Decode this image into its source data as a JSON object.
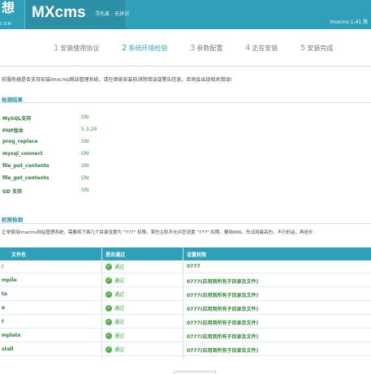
{
  "header": {
    "logo_char": "想",
    "logo_small": "COM",
    "brand": "MXcms",
    "slogan": "寻先离 - 无拼识",
    "version": "Imxcms 1.41 简"
  },
  "steps": [
    {
      "num": "1",
      "label": "安装使用协议",
      "active": false
    },
    {
      "num": "2",
      "label": "系统环境检验",
      "active": true
    },
    {
      "num": "3",
      "label": "参数配置",
      "active": false
    },
    {
      "num": "4",
      "label": "正在安装",
      "active": false
    },
    {
      "num": "5",
      "label": "安装完成",
      "active": false
    }
  ],
  "intro": "前服务器是否支持安装Imxcms网站管理系统，请在继续安装前消除错误或警告信息，否则会出现相关错误!",
  "env": {
    "title": "检测结果",
    "rows": [
      {
        "key": "MySQL支持",
        "value": "ON"
      },
      {
        "key": "PHP版本",
        "value": "5.3.29"
      },
      {
        "key": "preg_replace",
        "value": "ON"
      },
      {
        "key": "mysql_connect",
        "value": "ON"
      },
      {
        "key": "file_put_contents",
        "value": "ON"
      },
      {
        "key": "file_get_contents",
        "value": "ON"
      },
      {
        "key": "GD 支持",
        "value": "ON"
      }
    ]
  },
  "perm": {
    "title": "权限检测",
    "intro": "正常使用Imxcms网站管理系统，需要将下面几个目录设置为 \"777\" 权限。某些主机不允许您设置 \"777\" 权限，要用666。先试用最高的，不行的话，再逐步",
    "headers": {
      "name": "文件名",
      "status": "是否通过",
      "perm": "设置权限"
    },
    "rows": [
      {
        "name": "/",
        "status": "通过",
        "perm": "0777"
      },
      {
        "name": "mpile",
        "status": "通过",
        "perm": "0777(应用到所有子目录及文件)"
      },
      {
        "name": "ta",
        "status": "通过",
        "perm": "0777(应用到所有子目录及文件)"
      },
      {
        "name": "e",
        "status": "通过",
        "perm": "0777(应用到所有子目录及文件)"
      },
      {
        "name": "t",
        "status": "通过",
        "perm": "0777(应用到所有子目录及文件)"
      },
      {
        "name": "mplate",
        "status": "通过",
        "perm": "0777(应用到所有子目录及文件)"
      },
      {
        "name": "stall",
        "status": "通过",
        "perm": "0777(应用到所有子目录及文件)"
      }
    ]
  },
  "colors": {
    "accent": "#2fa0b8",
    "ok": "#2f9a3a"
  }
}
